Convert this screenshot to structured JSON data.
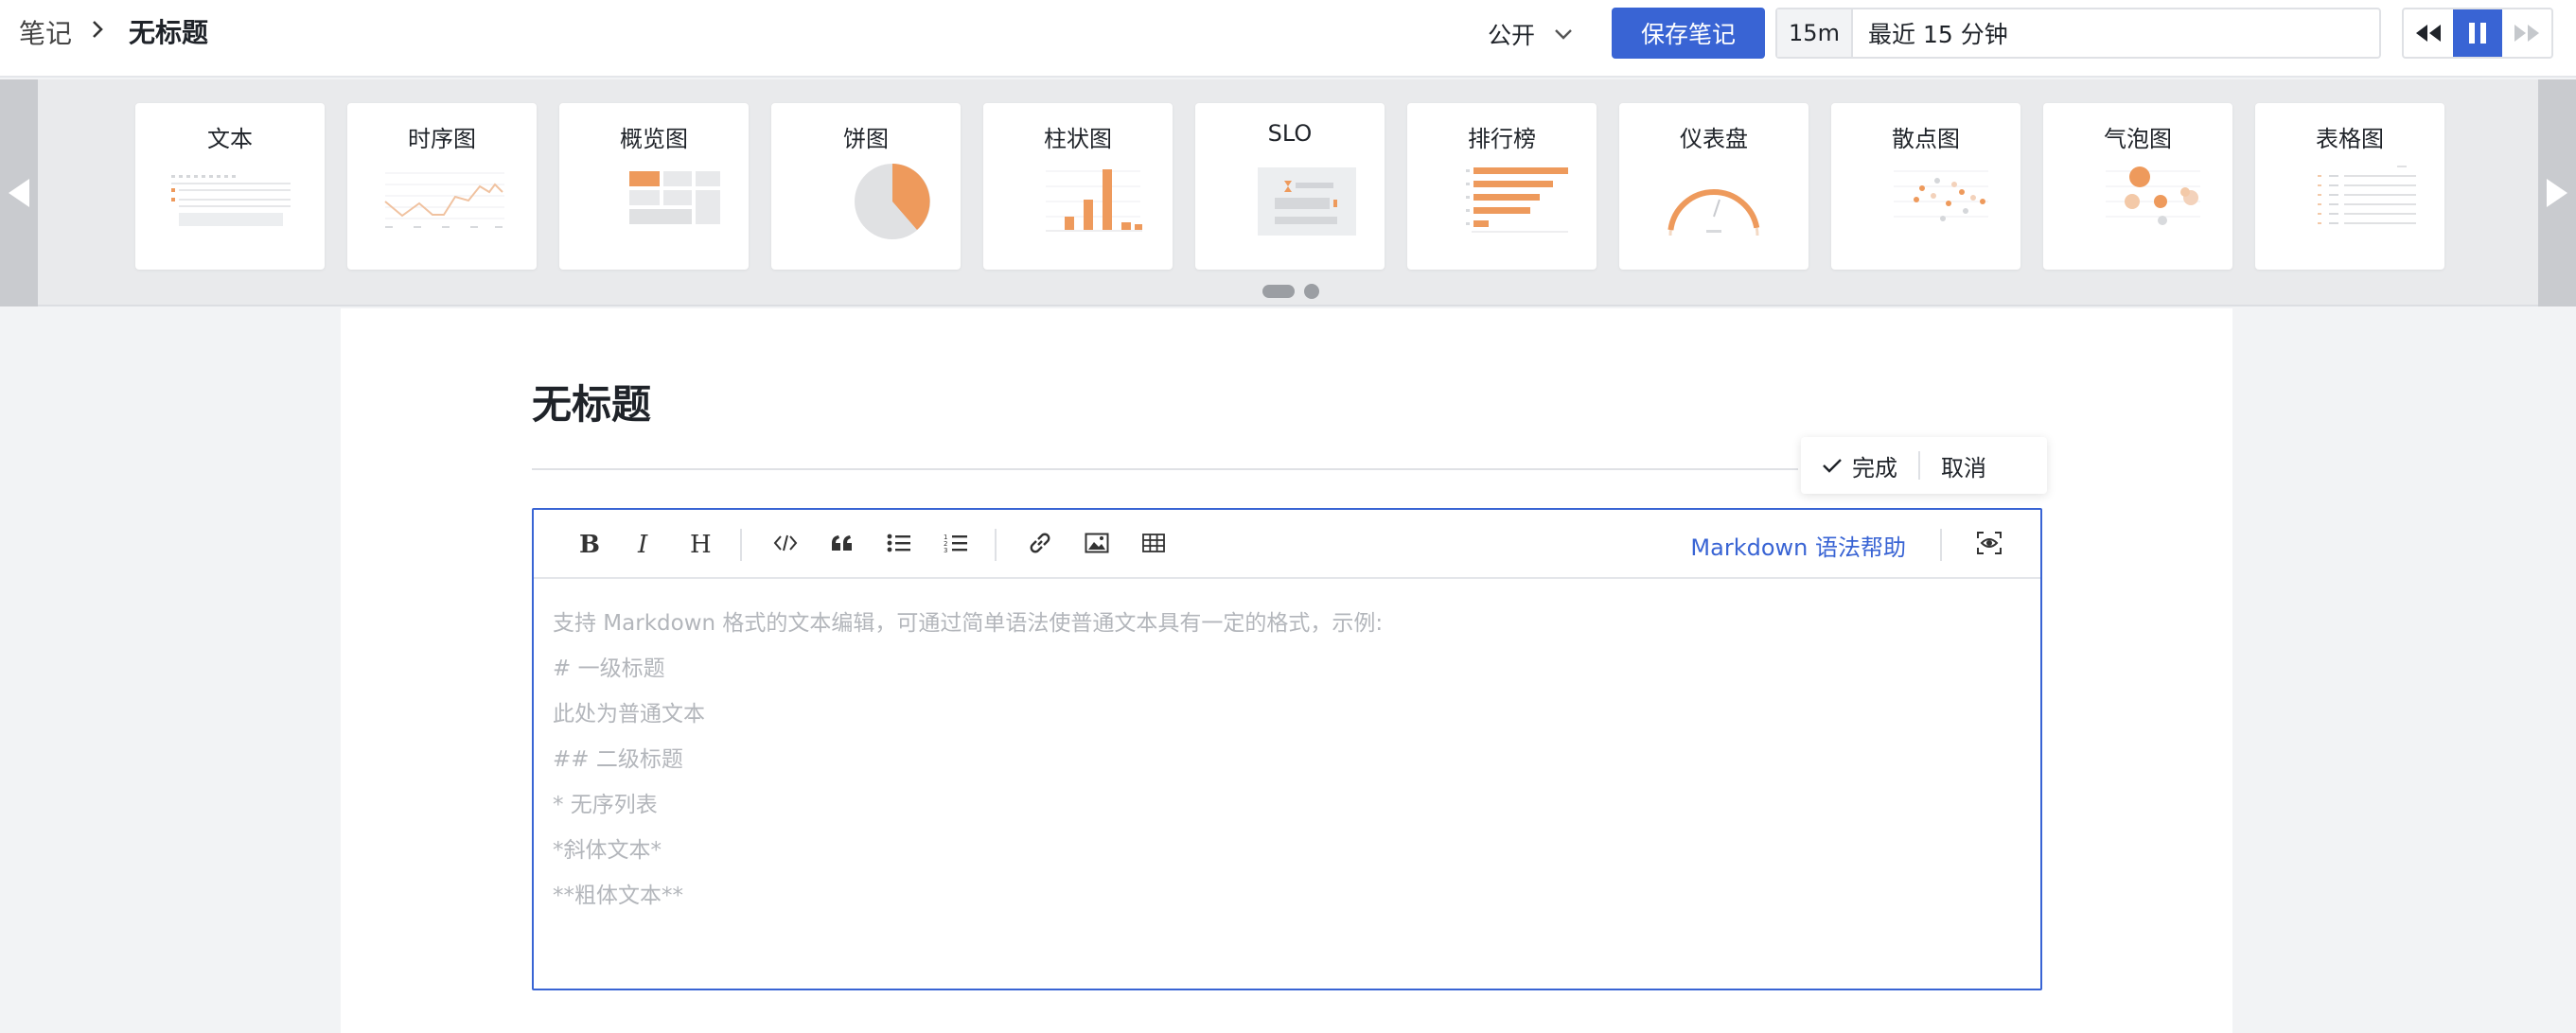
{
  "breadcrumb": {
    "root": "笔记",
    "current": "无标题"
  },
  "header": {
    "visibility": "公开",
    "save_label": "保存笔记",
    "time_short": "15m",
    "time_range": "最近 15 分钟"
  },
  "chart_types": [
    {
      "label": "文本",
      "icon": "text-preview-icon"
    },
    {
      "label": "时序图",
      "icon": "timeseries-preview-icon"
    },
    {
      "label": "概览图",
      "icon": "overview-preview-icon"
    },
    {
      "label": "饼图",
      "icon": "pie-preview-icon"
    },
    {
      "label": "柱状图",
      "icon": "bar-preview-icon"
    },
    {
      "label": "SLO",
      "icon": "slo-preview-icon"
    },
    {
      "label": "排行榜",
      "icon": "toplist-preview-icon"
    },
    {
      "label": "仪表盘",
      "icon": "gauge-preview-icon"
    },
    {
      "label": "散点图",
      "icon": "scatter-preview-icon"
    },
    {
      "label": "气泡图",
      "icon": "bubble-preview-icon"
    },
    {
      "label": "表格图",
      "icon": "table-preview-icon"
    }
  ],
  "note": {
    "title": "无标题"
  },
  "actions": {
    "done": "完成",
    "cancel": "取消"
  },
  "editor": {
    "help_link": "Markdown 语法帮助",
    "toolbar_icons": [
      "bold-icon",
      "italic-icon",
      "heading-icon",
      "code-icon",
      "quote-icon",
      "bullet-list-icon",
      "ordered-list-icon",
      "link-icon",
      "image-icon",
      "table-icon",
      "preview-icon"
    ],
    "placeholder_lines": [
      "支持 Markdown 格式的文本编辑，可通过简单语法使普通文本具有一定的格式，示例:",
      "# 一级标题",
      "此处为普通文本",
      "## 二级标题",
      "* 无序列表",
      "*斜体文本*",
      "**粗体文本**"
    ]
  },
  "colors": {
    "accent": "#3964d4",
    "chart_orange": "#ee9a5c"
  }
}
